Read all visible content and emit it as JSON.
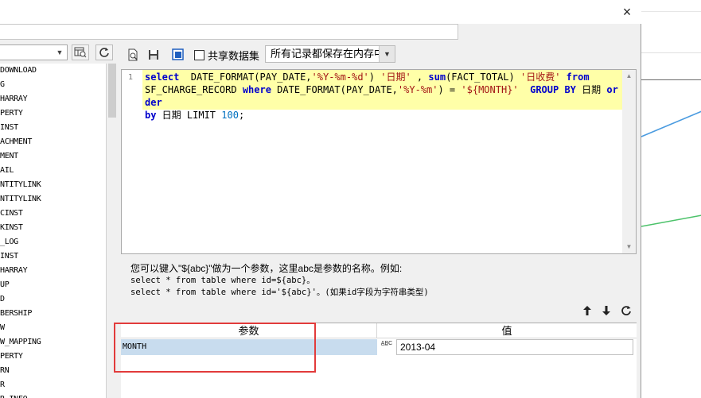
{
  "dialog": {
    "close_label": "×"
  },
  "left_list": {
    "items": [
      "DOWNLOAD",
      "G",
      "HARRAY",
      "PERTY",
      "INST",
      "ACHMENT",
      "MENT",
      "AIL",
      "NTITYLINK",
      "NTITYLINK",
      "CINST",
      "KINST",
      "_LOG",
      "INST",
      "HARRAY",
      "UP",
      "D",
      "BERSHIP",
      "W",
      "W_MAPPING",
      "PERTY",
      "RN",
      "R",
      "R_INFO"
    ]
  },
  "toolbar": {
    "share_dataset_label": "共享数据集",
    "storage_mode": "所有记录都保存在内存中"
  },
  "editor": {
    "line_number": "1",
    "tokens": [
      {
        "t": "kw",
        "v": "select"
      },
      {
        "t": "p",
        "v": "  DATE_FORMAT(PAY_DATE,"
      },
      {
        "t": "str",
        "v": "'%Y-%m-%d'"
      },
      {
        "t": "p",
        "v": ") "
      },
      {
        "t": "str",
        "v": "'日期'"
      },
      {
        "t": "p",
        "v": " , "
      },
      {
        "t": "kw",
        "v": "sum"
      },
      {
        "t": "p",
        "v": "(FACT_TOTAL) "
      },
      {
        "t": "str",
        "v": "'日收费'"
      },
      {
        "t": "p",
        "v": " "
      },
      {
        "t": "kw",
        "v": "from"
      },
      {
        "t": "p",
        "v": "\nSF_CHARGE_RECORD "
      },
      {
        "t": "kw",
        "v": "where"
      },
      {
        "t": "p",
        "v": " DATE_FORMAT(PAY_DATE,"
      },
      {
        "t": "str",
        "v": "'%Y-%m'"
      },
      {
        "t": "p",
        "v": ") = "
      },
      {
        "t": "str",
        "v": "'${MONTH}'"
      },
      {
        "t": "p",
        "v": "  "
      },
      {
        "t": "kw",
        "v": "GROUP BY"
      },
      {
        "t": "p",
        "v": " 日期 "
      },
      {
        "t": "kw",
        "v": "order"
      },
      {
        "t": "p",
        "v": "\n"
      },
      {
        "t": "kw",
        "v": "by"
      },
      {
        "t": "p",
        "v": " 日期 LIMIT "
      },
      {
        "t": "num",
        "v": "100"
      },
      {
        "t": "p",
        "v": ";"
      }
    ]
  },
  "hint": {
    "line1": "您可以键入\"${abc}\"做为一个参数，这里abc是参数的名称。例如:",
    "line2": "select * from table where id=${abc}。",
    "line3": "select * from table where id='${abc}'。(如果id字段为字符串类型)"
  },
  "params": {
    "header_name": "参数",
    "header_value": "值",
    "rows": [
      {
        "name": "MONTH",
        "type_icon": "A̲B̲C",
        "value": "2013-04"
      }
    ]
  },
  "colors": {
    "highlight_box": "#e23b3b",
    "selected_row": "#c8dcee",
    "code_line_bg": "#ffffa8",
    "keyword": "#0000cc",
    "string": "#a31515"
  }
}
